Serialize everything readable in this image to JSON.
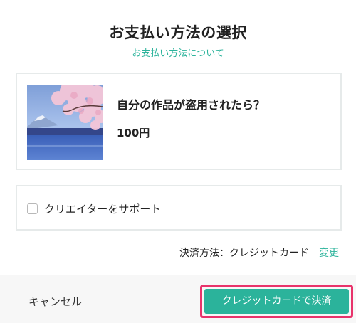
{
  "dialog": {
    "title": "お支払い方法の選択",
    "about_link": "お支払い方法について"
  },
  "product": {
    "title": "自分の作品が盗用されたら？",
    "price": "100円",
    "thumbnail": "cherry-blossom-mountain-lake-image"
  },
  "support": {
    "label": "クリエイターをサポート",
    "checked": false
  },
  "payment": {
    "method_text": "決済方法：クレジットカード",
    "change_label": "変更"
  },
  "footer": {
    "cancel_label": "キャンセル",
    "pay_label": "クレジットカードで決済"
  },
  "colors": {
    "accent": "#2bb39b",
    "highlight_outline": "#e8336b",
    "border": "#e6eaea",
    "footer_bg": "#f7f7f7"
  }
}
